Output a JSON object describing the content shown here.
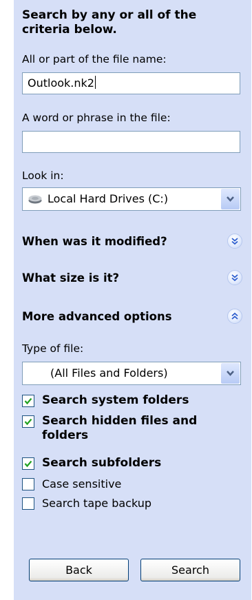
{
  "search": {
    "heading": "Search by any or all of the criteria below.",
    "file_name_label": "All or part of the file name:",
    "file_name_value": "Outlook.nk2",
    "phrase_label": "A word or phrase in the file:",
    "phrase_value": "",
    "look_in_label": "Look in:",
    "look_in_value": "Local Hard Drives (C:)",
    "look_in_icon": "hard-drive-icon"
  },
  "sections": {
    "modified": {
      "title": "When was it modified?",
      "expanded": false
    },
    "size": {
      "title": "What size is it?",
      "expanded": false
    },
    "advanced": {
      "title": "More advanced options",
      "expanded": true
    }
  },
  "advanced": {
    "type_label": "Type of file:",
    "type_value": "(All Files and Folders)",
    "options": [
      {
        "label": "Search system folders",
        "checked": true
      },
      {
        "label": "Search hidden files and folders",
        "checked": true
      },
      {
        "label": "Search subfolders",
        "checked": true
      },
      {
        "label": "Case sensitive",
        "checked": false
      },
      {
        "label": "Search tape backup",
        "checked": false
      }
    ]
  },
  "buttons": {
    "back": "Back",
    "search": "Search"
  },
  "colors": {
    "pane": "#d6dff7",
    "border": "#7f9db9",
    "check": "#21a121",
    "chevron": "#2d5ecf"
  }
}
